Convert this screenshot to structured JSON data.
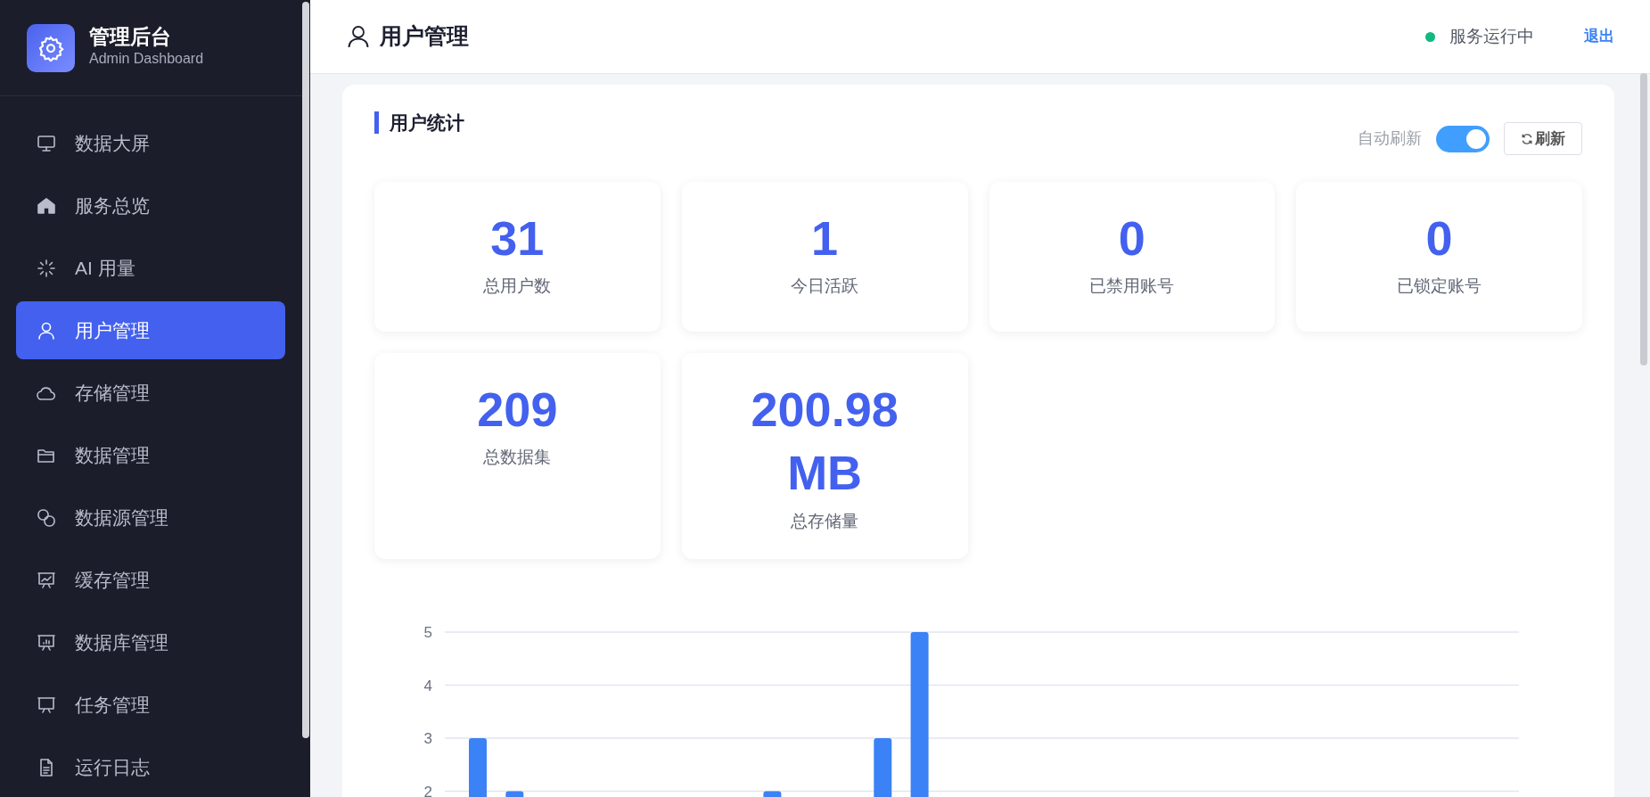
{
  "sidebar": {
    "logo_title": "管理后台",
    "logo_subtitle": "Admin Dashboard",
    "items": [
      {
        "label": "数据大屏",
        "selected": false
      },
      {
        "label": "服务总览",
        "selected": false
      },
      {
        "label": "AI 用量",
        "selected": false
      },
      {
        "label": "用户管理",
        "selected": true
      },
      {
        "label": "存储管理",
        "selected": false
      },
      {
        "label": "数据管理",
        "selected": false
      },
      {
        "label": "数据源管理",
        "selected": false
      },
      {
        "label": "缓存管理",
        "selected": false
      },
      {
        "label": "数据库管理",
        "selected": false
      },
      {
        "label": "任务管理",
        "selected": false
      },
      {
        "label": "运行日志",
        "selected": false
      }
    ]
  },
  "header": {
    "title": "用户管理",
    "status": {
      "text": "服务运行中",
      "online": true
    },
    "logout": "退出"
  },
  "panel": {
    "title": "用户统计",
    "auto_refresh": {
      "label": "自动刷新",
      "on": true
    },
    "refresh_button": "刷新",
    "stats": [
      {
        "value": "31",
        "label": "总用户数"
      },
      {
        "value": "1",
        "label": "今日活跃"
      },
      {
        "value": "0",
        "label": "已禁用账号"
      },
      {
        "value": "0",
        "label": "已锁定账号"
      },
      {
        "value": "209",
        "label": "总数据集"
      },
      {
        "value": "200.98 MB",
        "label": "总存储量"
      }
    ],
    "chart_data": {
      "type": "bar",
      "grid": true,
      "ylim": [
        0,
        5
      ],
      "yticks": [
        2,
        3,
        4,
        5
      ],
      "series": [
        {
          "color": "#3b82f6",
          "values": [
            3,
            2,
            null,
            null,
            null,
            null,
            null,
            null,
            2,
            null,
            null,
            3,
            5,
            null,
            null,
            null,
            null,
            null,
            null,
            null,
            null,
            null,
            null,
            null,
            null,
            null,
            null,
            null,
            null
          ]
        }
      ]
    }
  }
}
